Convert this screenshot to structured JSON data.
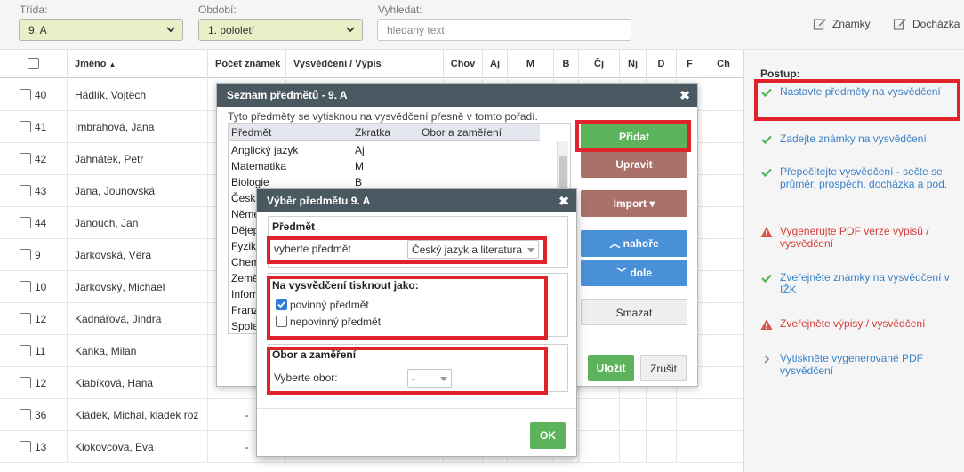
{
  "filters": {
    "class_label": "Třída:",
    "class_value": "9. A",
    "period_label": "Období:",
    "period_value": "1. pololetí",
    "search_label": "Vyhledat:",
    "search_placeholder": "hledaný text"
  },
  "toplinks": {
    "grades": "Známky",
    "attendance": "Docházka"
  },
  "table": {
    "headers": [
      "Jméno",
      "Počet známek",
      "Vysvědčení / Výpis",
      "Chov",
      "Aj",
      "M",
      "B",
      "Čj",
      "Nj",
      "D",
      "F",
      "Ch"
    ],
    "rows": [
      {
        "num": "40",
        "name": "Hádlík, Vojtěch",
        "count": ""
      },
      {
        "num": "41",
        "name": "Imbrahová, Jana",
        "count": ""
      },
      {
        "num": "42",
        "name": "Jahnátek, Petr",
        "count": ""
      },
      {
        "num": "43",
        "name": "Jana, Jounovská",
        "count": ""
      },
      {
        "num": "44",
        "name": "Janouch, Jan",
        "count": ""
      },
      {
        "num": "9",
        "name": "Jarkovská, Věra",
        "count": ""
      },
      {
        "num": "10",
        "name": "Jarkovský, Michael",
        "count": ""
      },
      {
        "num": "12",
        "name": "Kadnářová, Jindra",
        "count": ""
      },
      {
        "num": "11",
        "name": "Kaňka, Milan",
        "count": ""
      },
      {
        "num": "12",
        "name": "Klabíková, Hana",
        "count": ""
      },
      {
        "num": "36",
        "name": "Kládek, Michal, kladek roz",
        "count": "-"
      },
      {
        "num": "13",
        "name": "Klokovcova, Eva",
        "count": "-"
      }
    ]
  },
  "panel": {
    "title": "Postup:",
    "steps": [
      {
        "text": "Nastavte předměty na vysvědčení",
        "status": "ok"
      },
      {
        "text": "Zadejte známky na vysvědčení",
        "status": "ok"
      },
      {
        "text": "Přepočítejte vysvědčení - sečte se průměr, prospěch, docházka a pod.",
        "status": "ok"
      },
      {
        "text": "Vygenerujte PDF verze výpisů / vysvědčení",
        "status": "warn"
      },
      {
        "text": "Zveřejněte známky na vysvědčení v IŽK",
        "status": "ok"
      },
      {
        "text": "Zveřejněte výpisy / vysvědčení",
        "status": "warn"
      },
      {
        "text": "Vytiskněte vygenerované PDF vysvědčení",
        "status": "next"
      }
    ]
  },
  "modal1": {
    "title": "Seznam předmětů - 9. A",
    "description": "Tyto předměty se vytisknou na vysvědčení přesně v tomto pořadí.",
    "col_subject": "Předmět",
    "col_abbr": "Zkratka",
    "col_field": "Obor a zaměření",
    "subjects": [
      {
        "name": "Anglický jazyk",
        "abbr": "Aj"
      },
      {
        "name": "Matematika",
        "abbr": "M"
      },
      {
        "name": "Biologie",
        "abbr": "B"
      },
      {
        "name": "Česk",
        "abbr": ""
      },
      {
        "name": "Něme",
        "abbr": ""
      },
      {
        "name": "Dějep",
        "abbr": ""
      },
      {
        "name": "Fyzik",
        "abbr": ""
      },
      {
        "name": "Chem",
        "abbr": ""
      },
      {
        "name": "Země",
        "abbr": ""
      },
      {
        "name": "Inforr",
        "abbr": ""
      },
      {
        "name": "Franz",
        "abbr": ""
      },
      {
        "name": "Spole",
        "abbr": ""
      }
    ],
    "btn_add": "Přidat",
    "btn_edit": "Upravit",
    "btn_import": "Import ▾",
    "btn_up": "nahoře",
    "btn_down": "dole",
    "btn_delete": "Smazat",
    "btn_save": "Uložit",
    "btn_cancel": "Zrušit"
  },
  "modal2": {
    "title": "Výběr předmětu 9. A",
    "section_subject": "Předmět",
    "subject_label": "vyberte předmět",
    "subject_value": "Český jazyk a literatura",
    "section_print": "Na vysvědčení tisknout jako:",
    "opt_required": "povinný předmět",
    "opt_optional": "nepovinný předmět",
    "section_field": "Obor a zaměření",
    "field_label": "Vyberte obor:",
    "field_value": "-",
    "btn_ok": "OK"
  },
  "colors": {
    "header": "#4a5961",
    "green": "#5cb35c",
    "brown": "#a97167",
    "blue": "#4a90d9",
    "highlight": "#e0222a"
  }
}
